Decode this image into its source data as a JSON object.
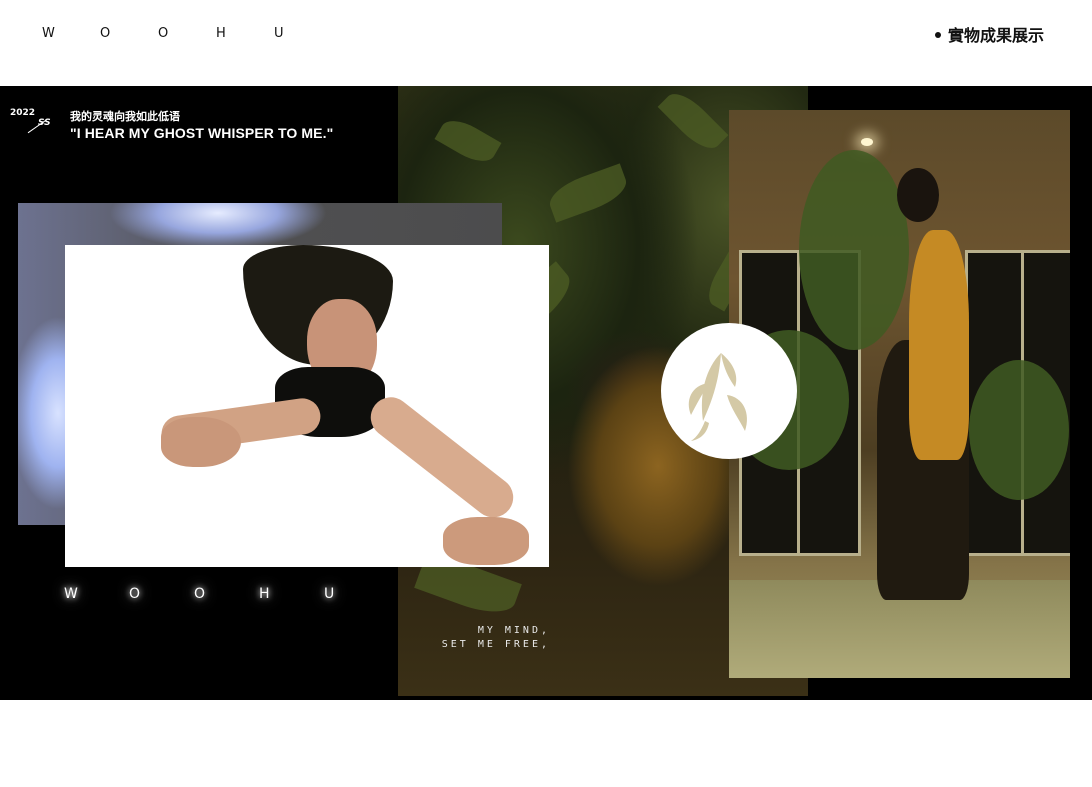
{
  "header": {
    "brand_letters": [
      "W",
      "O",
      "O",
      "H",
      "U"
    ],
    "nav_link": "實物成果展示"
  },
  "hero": {
    "year_top": "2022",
    "season": "SS",
    "subtitle_cn": "我的灵魂向我如此低语",
    "quote_en": "\"I HEAR  MY GHOST WHISPER TO ME.\"",
    "brand_glow_letters": [
      "W",
      "O",
      "O",
      "H",
      "U"
    ],
    "slogan_line1": "MY MIND,",
    "slogan_line2": "SET ME FREE,"
  },
  "colors": {
    "stage_bg": "#000000",
    "page_bg": "#ffffff",
    "emblem_leaf": "#d4c9a6"
  },
  "icons": {
    "emblem": "orchid-emblem-icon",
    "nav_bullet": "bullet-dot-icon"
  }
}
